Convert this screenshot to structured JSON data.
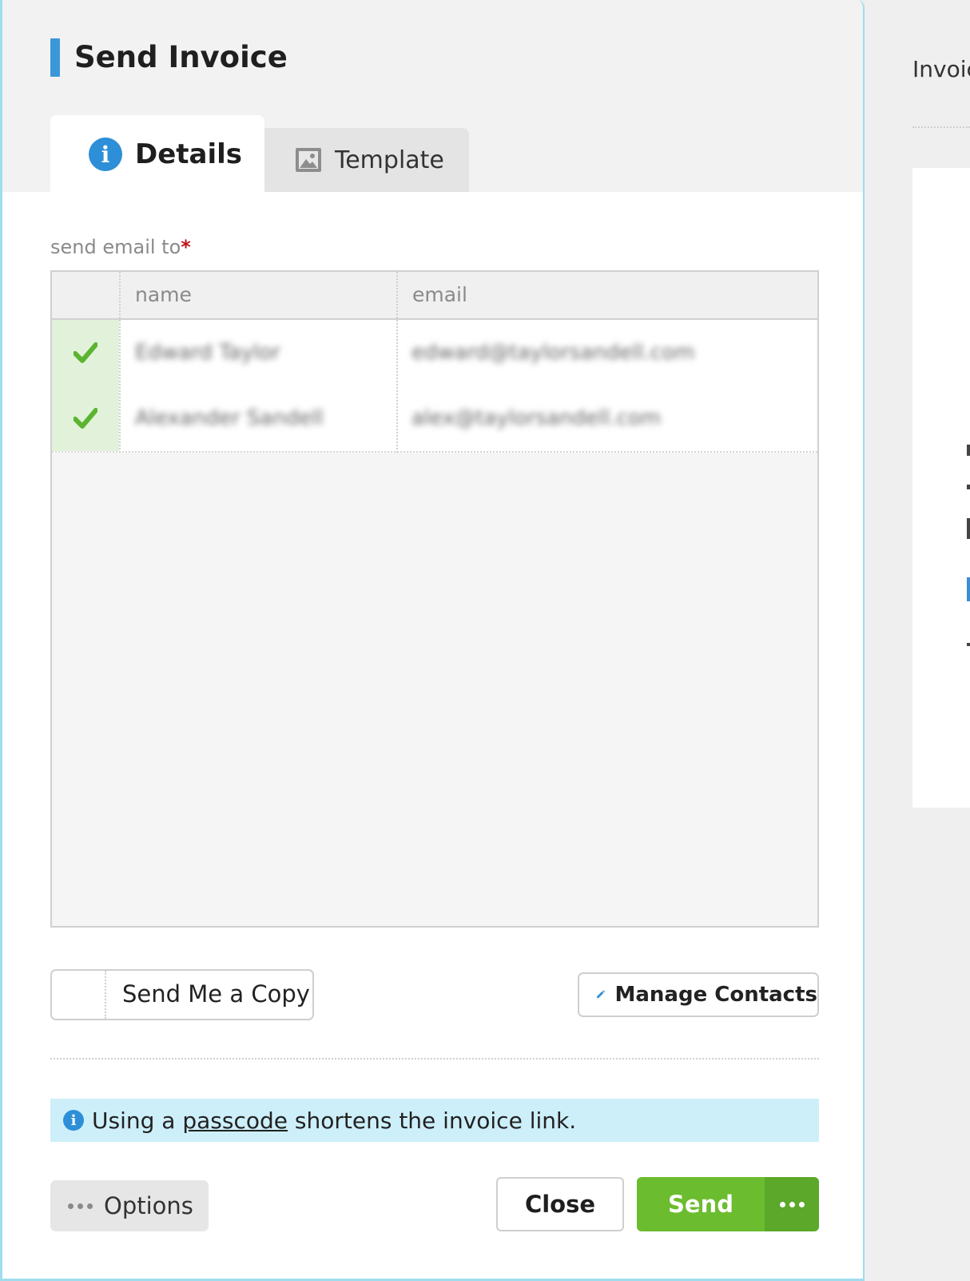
{
  "dialog": {
    "title": "Send Invoice",
    "tabs": [
      {
        "label": "Details",
        "icon": "info-icon",
        "active": true
      },
      {
        "label": "Template",
        "icon": "image-icon",
        "active": false
      }
    ]
  },
  "recipients": {
    "label": "send email to",
    "required_marker": "*",
    "columns": [
      "name",
      "email"
    ],
    "rows": [
      {
        "selected": true,
        "name": "Edward Taylor",
        "email": "edward@taylorsandell.com"
      },
      {
        "selected": true,
        "name": "Alexander Sandell",
        "email": "alex@taylorsandell.com"
      }
    ]
  },
  "actions": {
    "send_copy_label": "Send Me a Copy",
    "manage_contacts_label": "Manage Contacts",
    "options_label": "Options",
    "close_label": "Close",
    "send_label": "Send"
  },
  "notice": {
    "prefix": "Using a",
    "link": "passcode",
    "suffix": "shortens the invoice link."
  },
  "background_panel": {
    "title": "Invoic"
  },
  "colors": {
    "accent_blue": "#3c97d9",
    "send_green": "#6cbc2f",
    "notice_bg": "#cdeffa",
    "required_red": "#c0151d"
  }
}
